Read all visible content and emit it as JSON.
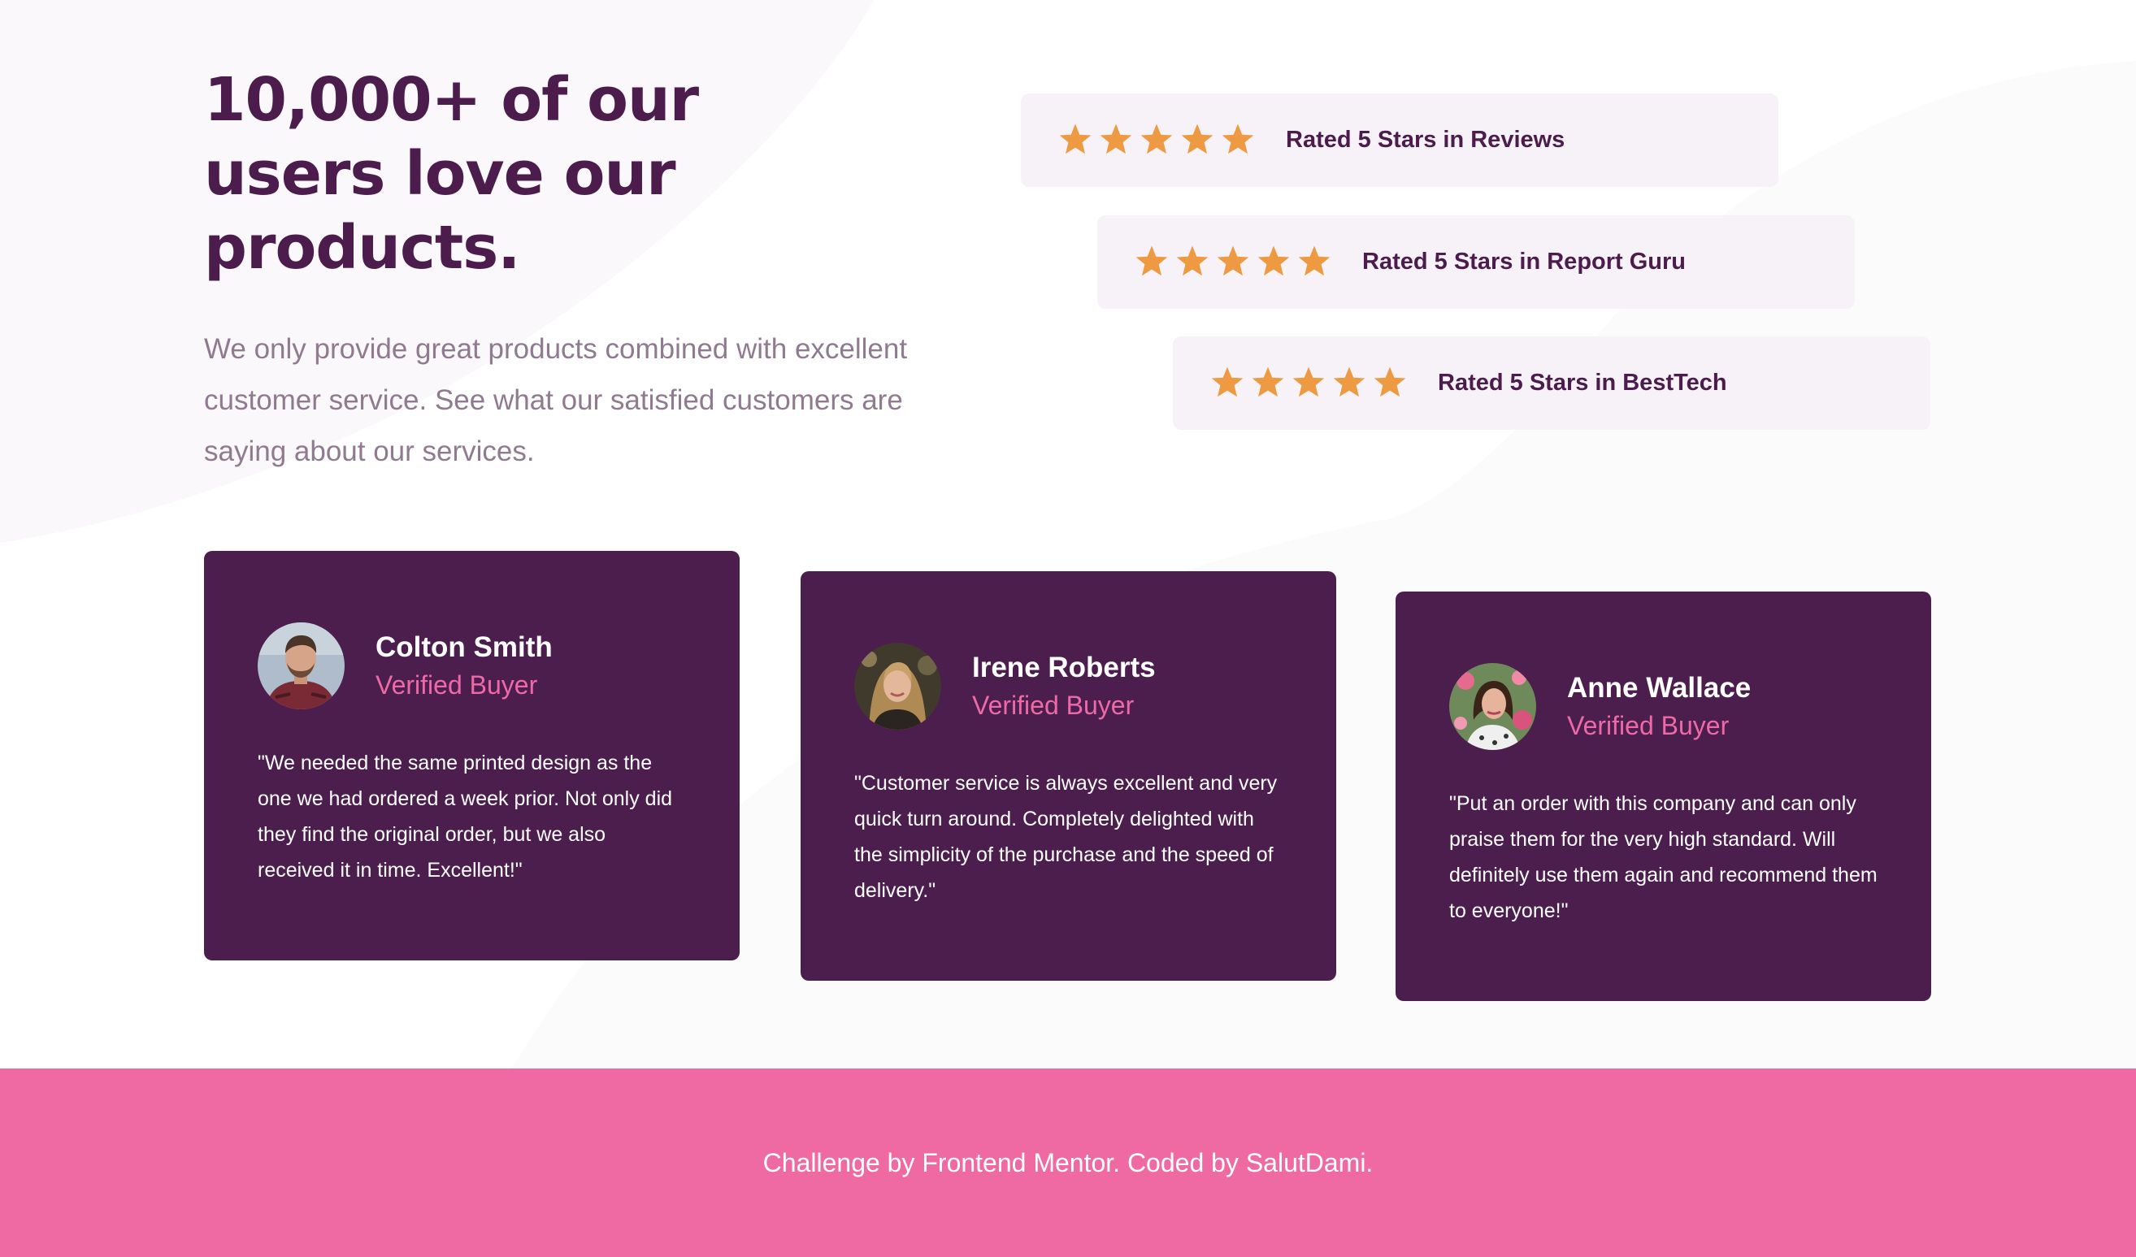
{
  "headline": "10,000+ of our users love our products.",
  "intro": "We only provide great products combined with excellent customer service. See what our satisfied customers are saying about our services.",
  "ratings": [
    {
      "label": "Rated 5 Stars in Reviews",
      "stars": 5
    },
    {
      "label": "Rated 5 Stars in Report Guru",
      "stars": 5
    },
    {
      "label": "Rated 5 Stars in BestTech",
      "stars": 5
    }
  ],
  "testimonials": [
    {
      "name": "Colton Smith",
      "badge": "Verified Buyer",
      "quote": "\"We needed the same printed design as the one we had ordered a week prior. Not only did they find the original order, but we also received it in time. Excellent!\""
    },
    {
      "name": "Irene Roberts",
      "badge": "Verified Buyer",
      "quote": "\"Customer service is always excellent and very quick turn around. Completely delighted with the simplicity of the purchase and the speed of delivery.\""
    },
    {
      "name": "Anne Wallace",
      "badge": "Verified Buyer",
      "quote": "\"Put an order with this company and can only praise them for the very high standard. Will definitely use them again and recommend them to everyone!\""
    }
  ],
  "footer": {
    "attribution": "Challenge by Frontend Mentor. Coded by SalutDami."
  },
  "colors": {
    "heading": "#4b1c4c",
    "card_bg": "#4b1e4e",
    "accent_pink": "#ee6aa7",
    "star_orange": "#ee9a42",
    "rating_bg": "#f7f2f8",
    "footer_bg": "#ef69a3"
  },
  "icons": {
    "rating_star": "star-icon"
  }
}
